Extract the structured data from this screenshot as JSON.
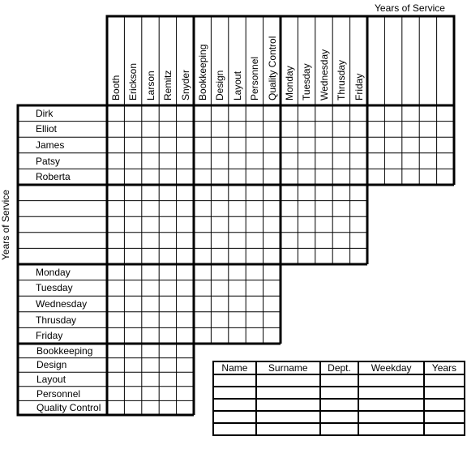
{
  "top_title": "Years of Service",
  "side_title": "Years of Service",
  "names": [
    "Dirk",
    "Elliot",
    "James",
    "Patsy",
    "Roberta"
  ],
  "surnames": [
    "Booth",
    "Erickson",
    "Larson",
    "Remitz",
    "Snyder"
  ],
  "departments": [
    "Bookkeeping",
    "Design",
    "Layout",
    "Personnel",
    "Quality Control"
  ],
  "weekdays": [
    "Monday",
    "Tuesday",
    "Wednesday",
    "Thrusday",
    "Friday"
  ],
  "answer_table": {
    "headers": [
      "Name",
      "Surname",
      "Dept.",
      "Weekday",
      "Years"
    ],
    "rows": [
      [
        "",
        "",
        "",
        "",
        ""
      ],
      [
        "",
        "",
        "",
        "",
        ""
      ],
      [
        "",
        "",
        "",
        "",
        ""
      ],
      [
        "",
        "",
        "",
        "",
        ""
      ],
      [
        "",
        "",
        "",
        "",
        ""
      ]
    ]
  }
}
